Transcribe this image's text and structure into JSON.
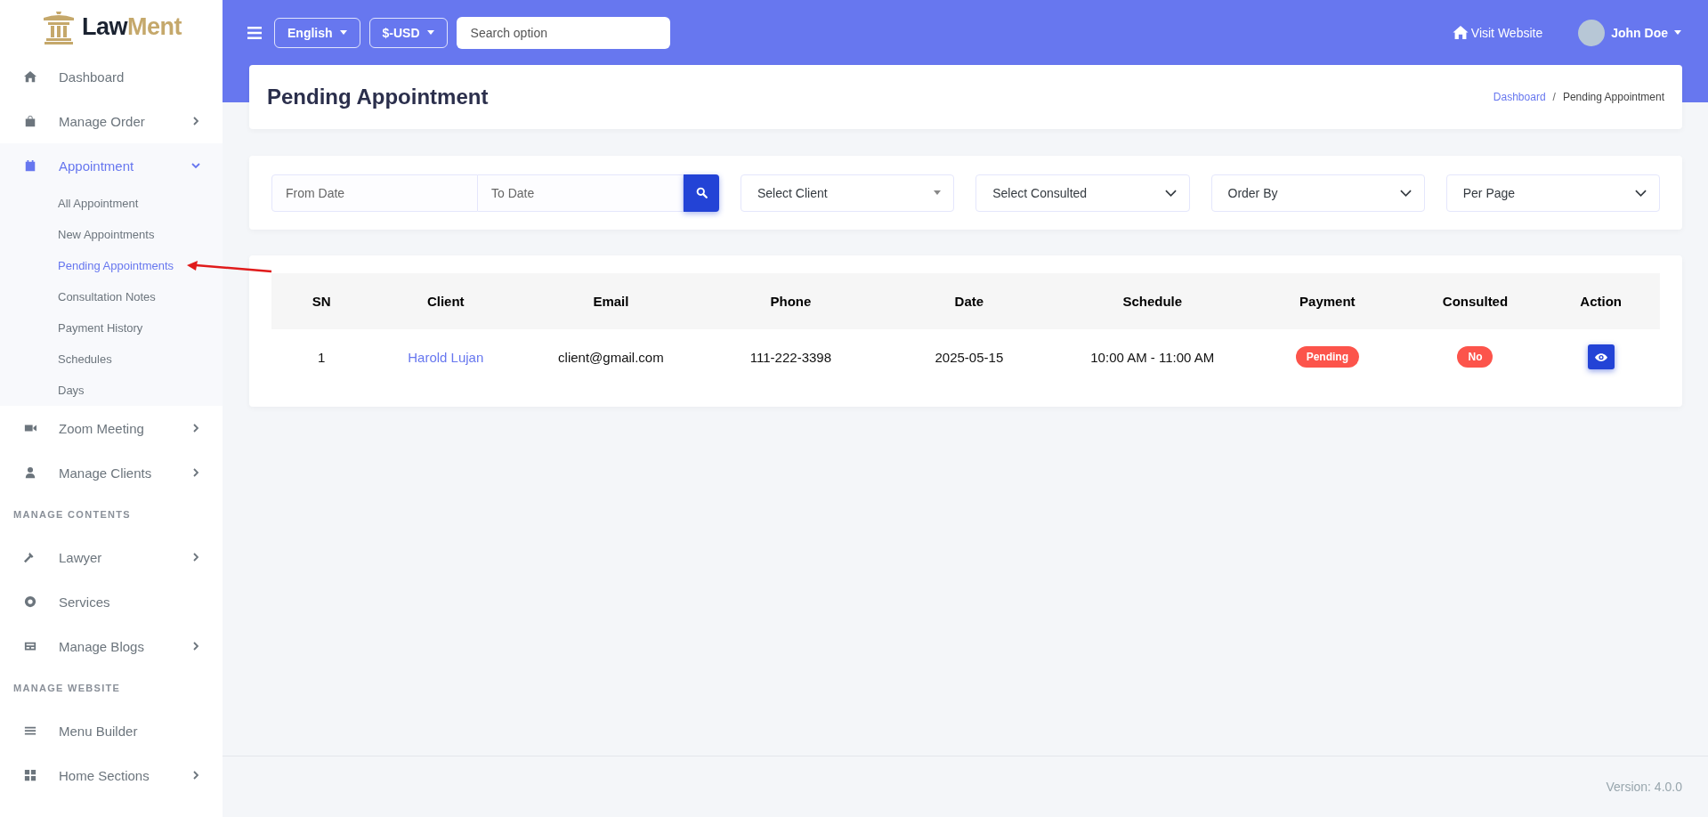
{
  "sidebar": {
    "logo": {
      "part_1": "Law",
      "part_2": "Ment"
    },
    "items": [
      {
        "kind": "link",
        "label": "Dashboard",
        "has_children": false,
        "selected": false
      },
      {
        "kind": "link",
        "label": "Manage Order",
        "has_children": true,
        "expanded": false,
        "selected": false
      },
      {
        "kind": "link",
        "label": "Appointment",
        "has_children": true,
        "expanded": true,
        "selected": true,
        "children": [
          {
            "label": "All Appointment",
            "selected": false
          },
          {
            "label": "New Appointments",
            "selected": false
          },
          {
            "label": "Pending Appointments",
            "selected": true
          },
          {
            "label": "Consultation Notes",
            "selected": false
          },
          {
            "label": "Payment History",
            "selected": false
          },
          {
            "label": "Schedules",
            "selected": false
          },
          {
            "label": "Days",
            "selected": false
          }
        ]
      },
      {
        "kind": "link",
        "label": "Zoom Meeting",
        "has_children": true,
        "expanded": false,
        "selected": false
      },
      {
        "kind": "link",
        "label": "Manage Clients",
        "has_children": true,
        "expanded": false,
        "selected": false
      },
      {
        "kind": "section",
        "label": "MANAGE CONTENTS"
      },
      {
        "kind": "link",
        "label": "Lawyer",
        "has_children": true,
        "expanded": false,
        "selected": false
      },
      {
        "kind": "link",
        "label": "Services",
        "has_children": false,
        "selected": false
      },
      {
        "kind": "link",
        "label": "Manage Blogs",
        "has_children": true,
        "expanded": false,
        "selected": false
      },
      {
        "kind": "section",
        "label": "MANAGE WEBSITE"
      },
      {
        "kind": "link",
        "label": "Menu Builder",
        "has_children": false,
        "selected": false
      },
      {
        "kind": "link",
        "label": "Home Sections",
        "has_children": true,
        "expanded": false,
        "selected": false
      }
    ]
  },
  "topbar": {
    "language": "English",
    "currency": "$-USD",
    "search": {
      "placeholder": "Search option"
    },
    "visit_website": "Visit Website",
    "user": "John Doe"
  },
  "page_header": {
    "title": "Pending Appointment",
    "separator": "/",
    "breadcrumb": [
      {
        "label": "Dashboard",
        "kind": "link"
      },
      {
        "label": "Pending Appointment",
        "kind": "current"
      }
    ]
  },
  "filters": {
    "from_date": {
      "placeholder": "From Date"
    },
    "to_date": {
      "placeholder": "To Date"
    },
    "selects": [
      {
        "label": "Select Client",
        "kind": "select2"
      },
      {
        "label": "Select Consulted",
        "kind": "select"
      },
      {
        "label": "Order By",
        "kind": "select"
      },
      {
        "label": "Per Page",
        "kind": "select"
      }
    ]
  },
  "table": {
    "columns": [
      "SN",
      "Client",
      "Email",
      "Phone",
      "Date",
      "Schedule",
      "Payment",
      "Consulted",
      "Action"
    ],
    "rows": [
      {
        "sn": "1",
        "client": "Harold Lujan",
        "email": "client@gmail.com",
        "phone": "111-222-3398",
        "date": "2025-05-15",
        "schedule": "10:00 AM - 11:00 AM",
        "payment": {
          "label": "Pending",
          "paid": false
        },
        "consulted": {
          "label": "No",
          "consulted": false
        }
      }
    ]
  },
  "footer": {
    "version": "Version: 4.0.0"
  }
}
